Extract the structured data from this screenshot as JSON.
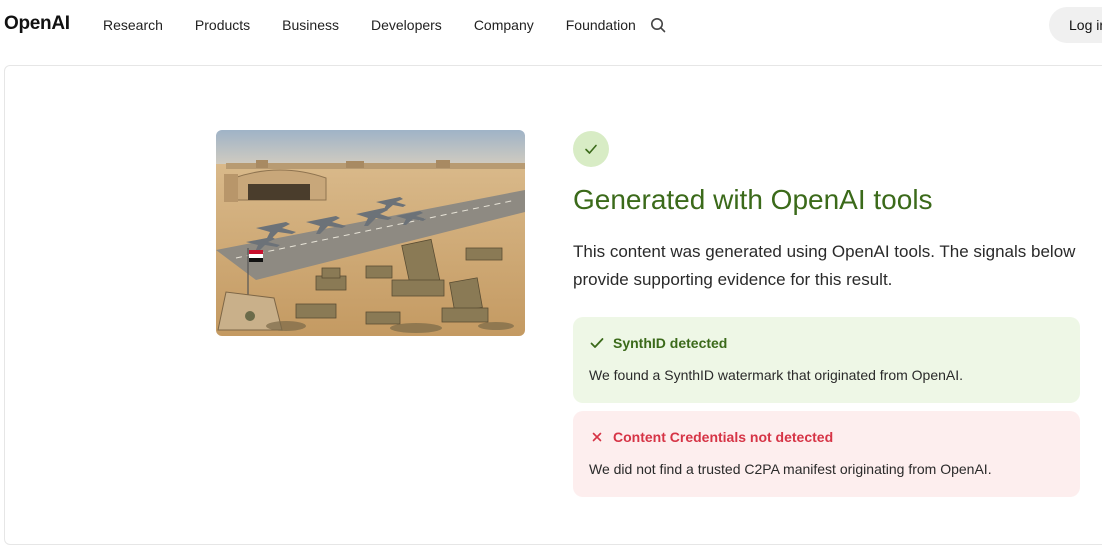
{
  "nav": {
    "logo": "OpenAI",
    "links": [
      "Research",
      "Products",
      "Business",
      "Developers",
      "Company",
      "Foundation"
    ],
    "search_icon": "search-icon",
    "login_label": "Log in"
  },
  "image": {
    "icon": "photo-military-airbase"
  },
  "result": {
    "status_icon": "check-icon",
    "headline": "Generated with OpenAI tools",
    "description": "This content was generated using OpenAI tools. The signals below provide supporting evidence for this result.",
    "accent_color": "#3b6a1a"
  },
  "signals": [
    {
      "icon": "check-icon",
      "title": "SynthID detected",
      "detail": "We found a SynthID watermark that originated from OpenAI.",
      "status": "detected",
      "color": "#3b6a1a"
    },
    {
      "icon": "close-icon",
      "title": "Content Credentials not detected",
      "detail": "We did not find a trusted C2PA manifest originating from OpenAI.",
      "status": "not-detected",
      "color": "#d63446"
    }
  ]
}
